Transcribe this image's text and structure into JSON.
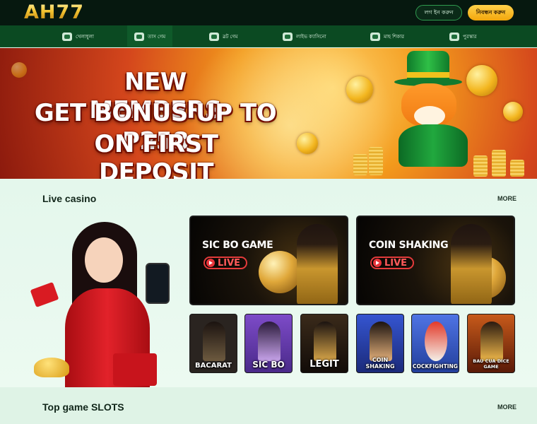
{
  "header": {
    "logo_text": "AH77",
    "login_label": "লগ ইন করুন",
    "register_label": "নিবন্ধন করুন"
  },
  "nav": {
    "items": [
      {
        "label": "খেলাধুলা",
        "icon": "sports-icon"
      },
      {
        "label": "তাস গেম",
        "icon": "cards-icon"
      },
      {
        "label": "স্লট গেম",
        "icon": "slot-icon"
      },
      {
        "label": "লাইভ ক্যাসিনো",
        "icon": "live-casino-icon"
      },
      {
        "label": "মাছ শিকার",
        "icon": "fish-icon"
      },
      {
        "label": "পুরস্কার",
        "icon": "gift-icon"
      }
    ]
  },
  "banner": {
    "line1": "NEW MEMBERS",
    "line2": "GET BONUS UP TO P258",
    "line3": "ON FIRST DEPOSIT"
  },
  "live_casino": {
    "title": "Live casino",
    "more_label": "MORE",
    "featured": [
      {
        "title": "SIC BO GAME",
        "badge": "LIVE"
      },
      {
        "title": "COIN SHAKING",
        "badge": "LIVE"
      }
    ],
    "games": [
      {
        "label": "BACARAT",
        "bg": "#2a2420"
      },
      {
        "label": "SIC BO",
        "bg": "#6a3fb0"
      },
      {
        "label": "LEGIT",
        "bg": "#3a2a1a"
      },
      {
        "label": "COIN SHAKING",
        "bg": "#2b3fa8"
      },
      {
        "label": "COCKFIGHTING",
        "bg": "#3d5fd0"
      },
      {
        "label": "BAU CUA DICE GAME",
        "bg": "#8a3a10"
      }
    ]
  },
  "slots": {
    "title": "Top game SLOTS",
    "more_label": "MORE"
  },
  "colors": {
    "header_bg": "#06180f",
    "nav_bg": "#0b4a22",
    "accent": "#f2a60c",
    "page_bg": "#e8f6ee"
  }
}
